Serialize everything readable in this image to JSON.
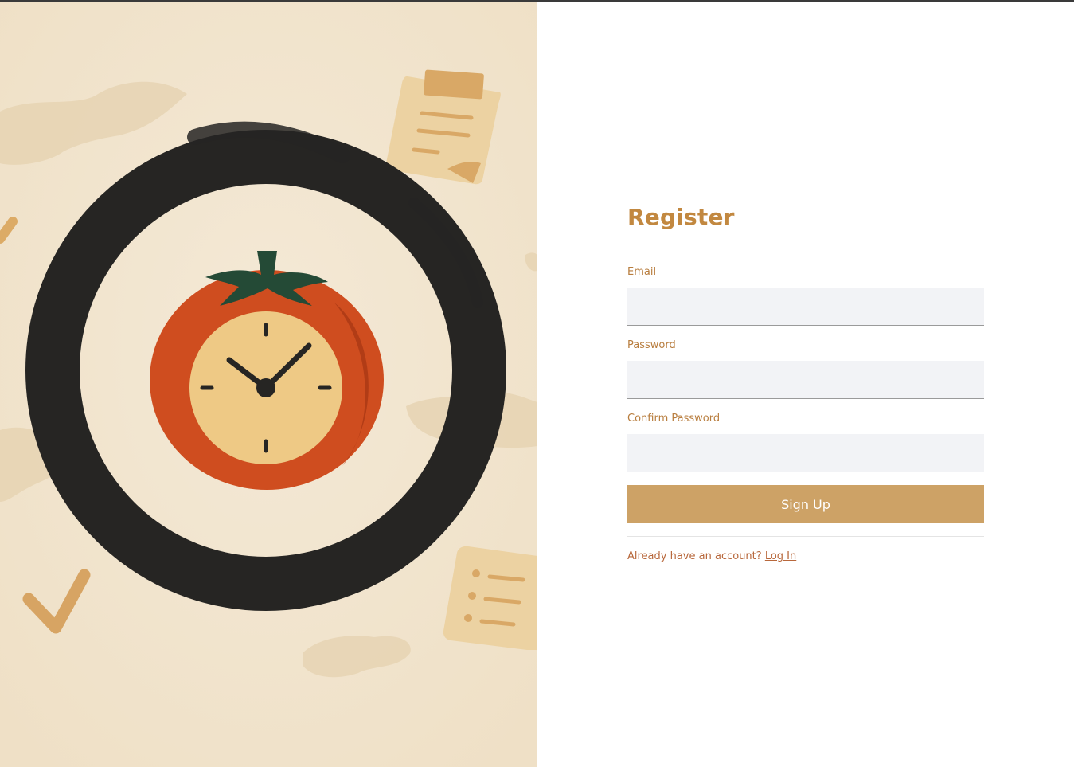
{
  "form": {
    "title": "Register",
    "email_label": "Email",
    "email_value": "",
    "password_label": "Password",
    "password_value": "",
    "confirm_label": "Confirm Password",
    "confirm_value": "",
    "submit_label": "Sign Up",
    "login_prompt": "Already have an account?",
    "login_link": "Log In"
  },
  "colors": {
    "accent": "#c28840",
    "button": "#cda266",
    "link": "#b8683c",
    "input_bg": "#f2f3f6",
    "illustration_bg": "#f2e6d2",
    "tomato": "#cf4d1f",
    "clock_face": "#eec985",
    "leaf": "#244a36",
    "brush_ring": "#262523"
  },
  "icons": [
    "pomodoro-clock-icon",
    "clipboard-icon",
    "checkmark-icon",
    "checklist-icon"
  ]
}
